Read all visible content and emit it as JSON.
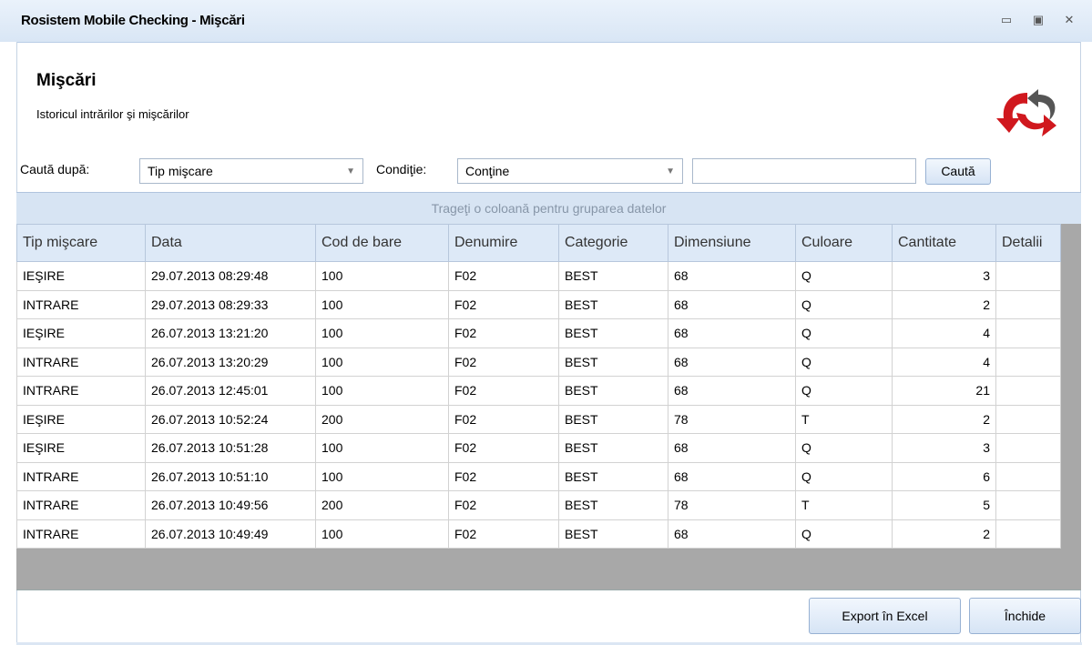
{
  "window": {
    "title": "Rosistem Mobile Checking - Mişcări"
  },
  "header": {
    "title": "Mişcări",
    "subtitle": "Istoricul intrărilor şi mişcărilor"
  },
  "search": {
    "by_label": "Caută după:",
    "by_value": "Tip mişcare",
    "condition_label": "Condiţie:",
    "condition_value": "Conţine",
    "text_value": "",
    "search_button": "Caută"
  },
  "grid": {
    "group_hint": "Trageţi o coloană pentru gruparea datelor",
    "columns": [
      "Tip mişcare",
      "Data",
      "Cod de bare",
      "Denumire",
      "Categorie",
      "Dimensiune",
      "Culoare",
      "Cantitate",
      "Detalii"
    ],
    "rows": [
      [
        "IEŞIRE",
        "29.07.2013 08:29:48",
        "100",
        "F02",
        "BEST",
        "68",
        "Q",
        "3",
        ""
      ],
      [
        "INTRARE",
        "29.07.2013 08:29:33",
        "100",
        "F02",
        "BEST",
        "68",
        "Q",
        "2",
        ""
      ],
      [
        "IEŞIRE",
        "26.07.2013 13:21:20",
        "100",
        "F02",
        "BEST",
        "68",
        "Q",
        "4",
        ""
      ],
      [
        "INTRARE",
        "26.07.2013 13:20:29",
        "100",
        "F02",
        "BEST",
        "68",
        "Q",
        "4",
        ""
      ],
      [
        "INTRARE",
        "26.07.2013 12:45:01",
        "100",
        "F02",
        "BEST",
        "68",
        "Q",
        "21",
        ""
      ],
      [
        "IEŞIRE",
        "26.07.2013 10:52:24",
        "200",
        "F02",
        "BEST",
        "78",
        "T",
        "2",
        ""
      ],
      [
        "IEŞIRE",
        "26.07.2013 10:51:28",
        "100",
        "F02",
        "BEST",
        "68",
        "Q",
        "3",
        ""
      ],
      [
        "INTRARE",
        "26.07.2013 10:51:10",
        "100",
        "F02",
        "BEST",
        "68",
        "Q",
        "6",
        ""
      ],
      [
        "INTRARE",
        "26.07.2013 10:49:56",
        "200",
        "F02",
        "BEST",
        "78",
        "T",
        "5",
        ""
      ],
      [
        "INTRARE",
        "26.07.2013 10:49:49",
        "100",
        "F02",
        "BEST",
        "68",
        "Q",
        "2",
        ""
      ]
    ]
  },
  "footer": {
    "export_button": "Export în Excel",
    "close_button": "Închide"
  },
  "icons": {
    "minimize": "minimize-icon",
    "maximize": "maximize-icon",
    "close": "close-icon",
    "logo": "sync-arrows-logo"
  }
}
